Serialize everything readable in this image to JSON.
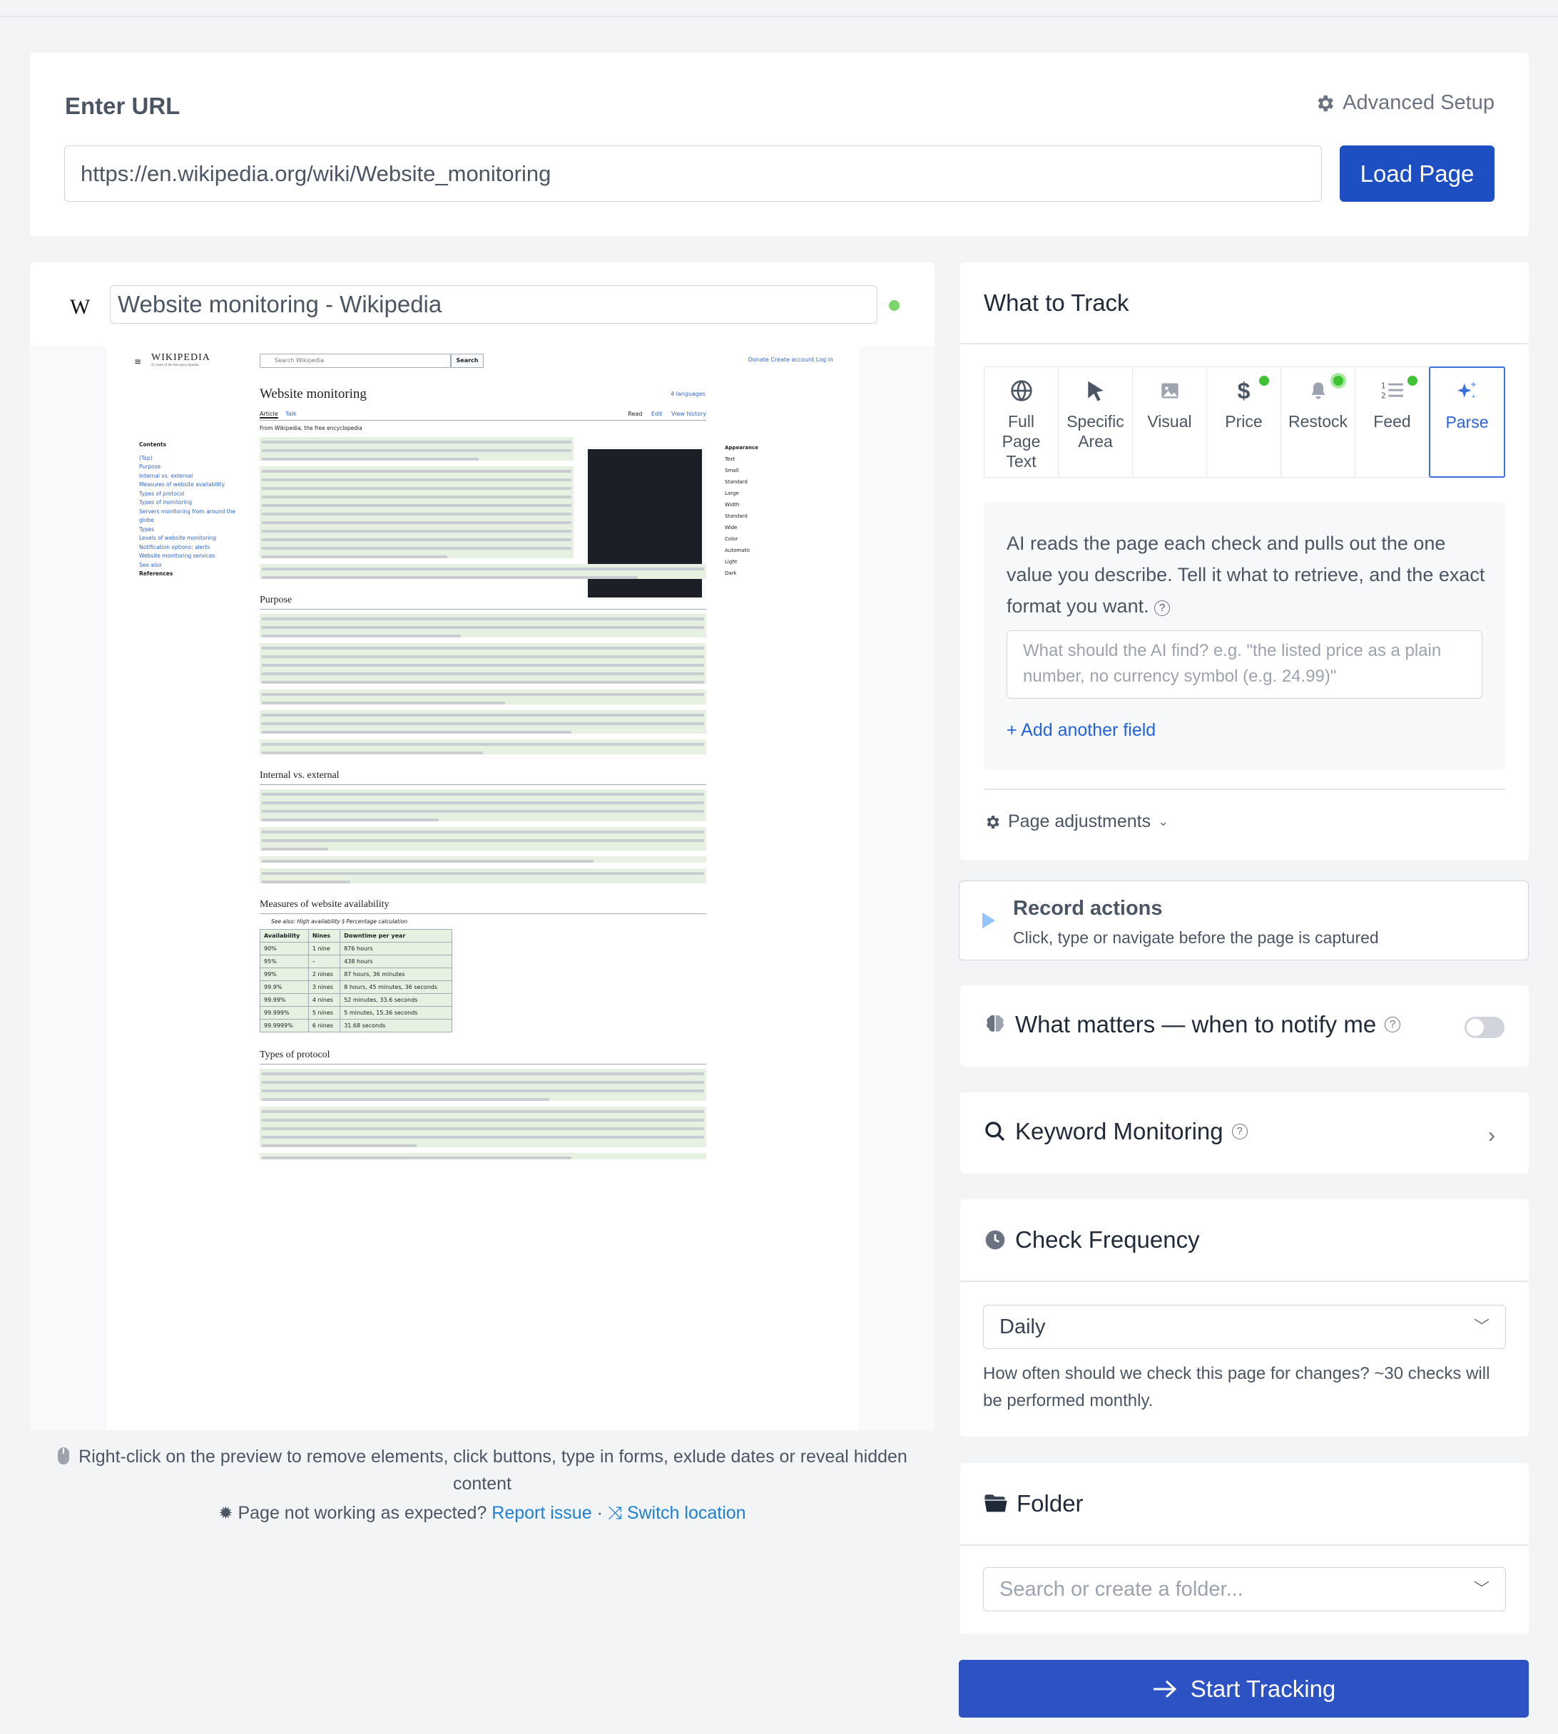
{
  "url_section": {
    "title": "Enter URL",
    "advanced_label": "Advanced Setup",
    "url_value": "https://en.wikipedia.org/wiki/Website_monitoring",
    "load_label": "Load Page"
  },
  "preview": {
    "favicon": "W",
    "page_title": "Website monitoring - Wikipedia",
    "hint": "Right-click on the preview to remove elements, click buttons, type in forms, exlude dates or reveal hidden content",
    "trouble_text": "Page not working as expected?",
    "report_link": "Report issue",
    "separator": "·",
    "switch_link": "Switch location"
  },
  "wiki": {
    "logo": "WIKIPEDIA",
    "logo_tag": "25 years of the free encyclopedia",
    "search_placeholder": "Search Wikipedia",
    "search_button": "Search",
    "top_links": "Donate  Create account  Log in",
    "heading": "Website monitoring",
    "languages": "4 languages",
    "tab_article": "Article",
    "tab_talk": "Talk",
    "tab_read": "Read",
    "tab_edit": "Edit",
    "tab_history": "View history",
    "from": "From Wikipedia, the free encyclopedia",
    "contents_title": "Contents",
    "contents": [
      "(Top)",
      "Purpose",
      "Internal vs. external",
      "Measures of website availability",
      "Types of protocol",
      "Types of monitoring",
      "Servers monitoring from around the globe",
      "Types",
      "Levels of website monitoring",
      "Notification options: alerts",
      "Website monitoring services",
      "See also",
      "References"
    ],
    "appearance_title": "Appearance",
    "appearance": [
      "Text",
      "Small",
      "Standard",
      "Large",
      "Width",
      "Standard",
      "Wide",
      "Color",
      "Automatic",
      "Light",
      "Dark"
    ],
    "h_purpose": "Purpose",
    "h_internal": "Internal vs. external",
    "h_measures": "Measures of website availability",
    "see_also": "See also: High availability § Percentage calculation",
    "h_protocol": "Types of protocol",
    "table_headers": [
      "Availability",
      "Nines",
      "Downtime per year"
    ],
    "table_rows": [
      [
        "90%",
        "1 nine",
        "876 hours"
      ],
      [
        "95%",
        "–",
        "438 hours"
      ],
      [
        "99%",
        "2 nines",
        "87 hours, 36 minutes"
      ],
      [
        "99.9%",
        "3 nines",
        "8 hours, 45 minutes, 36 seconds"
      ],
      [
        "99.99%",
        "4 nines",
        "52 minutes, 33.6 seconds"
      ],
      [
        "99.999%",
        "5 nines",
        "5 minutes, 15.36 seconds"
      ],
      [
        "99.9999%",
        "6 nines",
        "31.68 seconds"
      ]
    ]
  },
  "track": {
    "title": "What to Track",
    "tabs": [
      {
        "label": "Full Page Text",
        "icon": "globe-icon"
      },
      {
        "label": "Specific Area",
        "icon": "cursor-icon"
      },
      {
        "label": "Visual",
        "icon": "image-icon"
      },
      {
        "label": "Price",
        "icon": "dollar-icon"
      },
      {
        "label": "Restock",
        "icon": "bell-icon"
      },
      {
        "label": "Feed",
        "icon": "list-icon"
      },
      {
        "label": "Parse",
        "icon": "sparkles-icon"
      }
    ],
    "ai_description": "AI reads the page each check and pulls out the one value you describe. Tell it what to retrieve, and the exact format you want.",
    "ai_placeholder": "What should the AI find? e.g. \"the listed price as a plain number, no currency symbol (e.g. 24.99)\"",
    "add_field": "+ Add another field",
    "page_adjustments": "Page adjustments"
  },
  "record": {
    "title": "Record actions",
    "subtitle": "Click, type or navigate before the page is captured"
  },
  "matters": {
    "title": "What matters — when to notify me"
  },
  "keyword": {
    "title": "Keyword Monitoring"
  },
  "frequency": {
    "title": "Check Frequency",
    "selected": "Daily",
    "help": "How often should we check this page for changes? ~30 checks will be performed monthly."
  },
  "folder": {
    "title": "Folder",
    "placeholder": "Search or create a folder..."
  },
  "start_label": "Start Tracking",
  "colors": {
    "primary": "#1e4fc2",
    "link": "#1d7fd6",
    "status_green": "#3ec234",
    "parse_active": "#3b6fe0"
  }
}
